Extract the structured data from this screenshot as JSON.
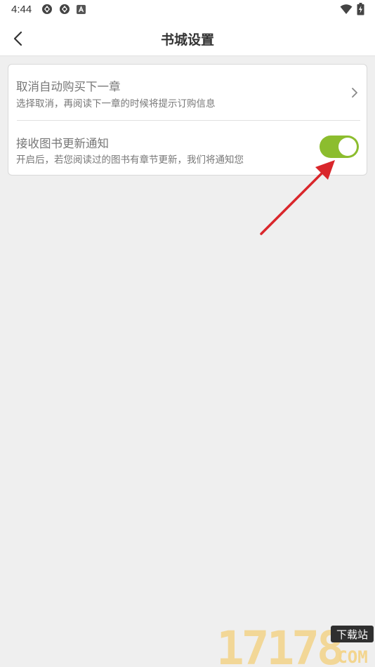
{
  "status_bar": {
    "time": "4:44",
    "left_icons": [
      "aperture-icon",
      "aperture-icon",
      "app-store-icon"
    ],
    "right_icons": [
      "wifi-icon",
      "battery-charging-icon"
    ]
  },
  "header": {
    "title": "书城设置",
    "back_icon": "chevron-left-icon"
  },
  "settings": [
    {
      "label": "取消自动购买下一章",
      "description": "选择取消，再阅读下一章的时候将提示订购信息",
      "control": "chevron-right-icon"
    },
    {
      "label": "接收图书更新通知",
      "description": "开启后，若您阅读过的图书有章节更新，我们将通知您",
      "control": "toggle",
      "enabled": true
    }
  ],
  "colors": {
    "toggle_on": "#8cbd2e",
    "annotation_arrow": "#d9262b",
    "background": "#efefef"
  },
  "watermark": {
    "number": "17178",
    "badge": "下载站",
    "domain": "COM"
  }
}
